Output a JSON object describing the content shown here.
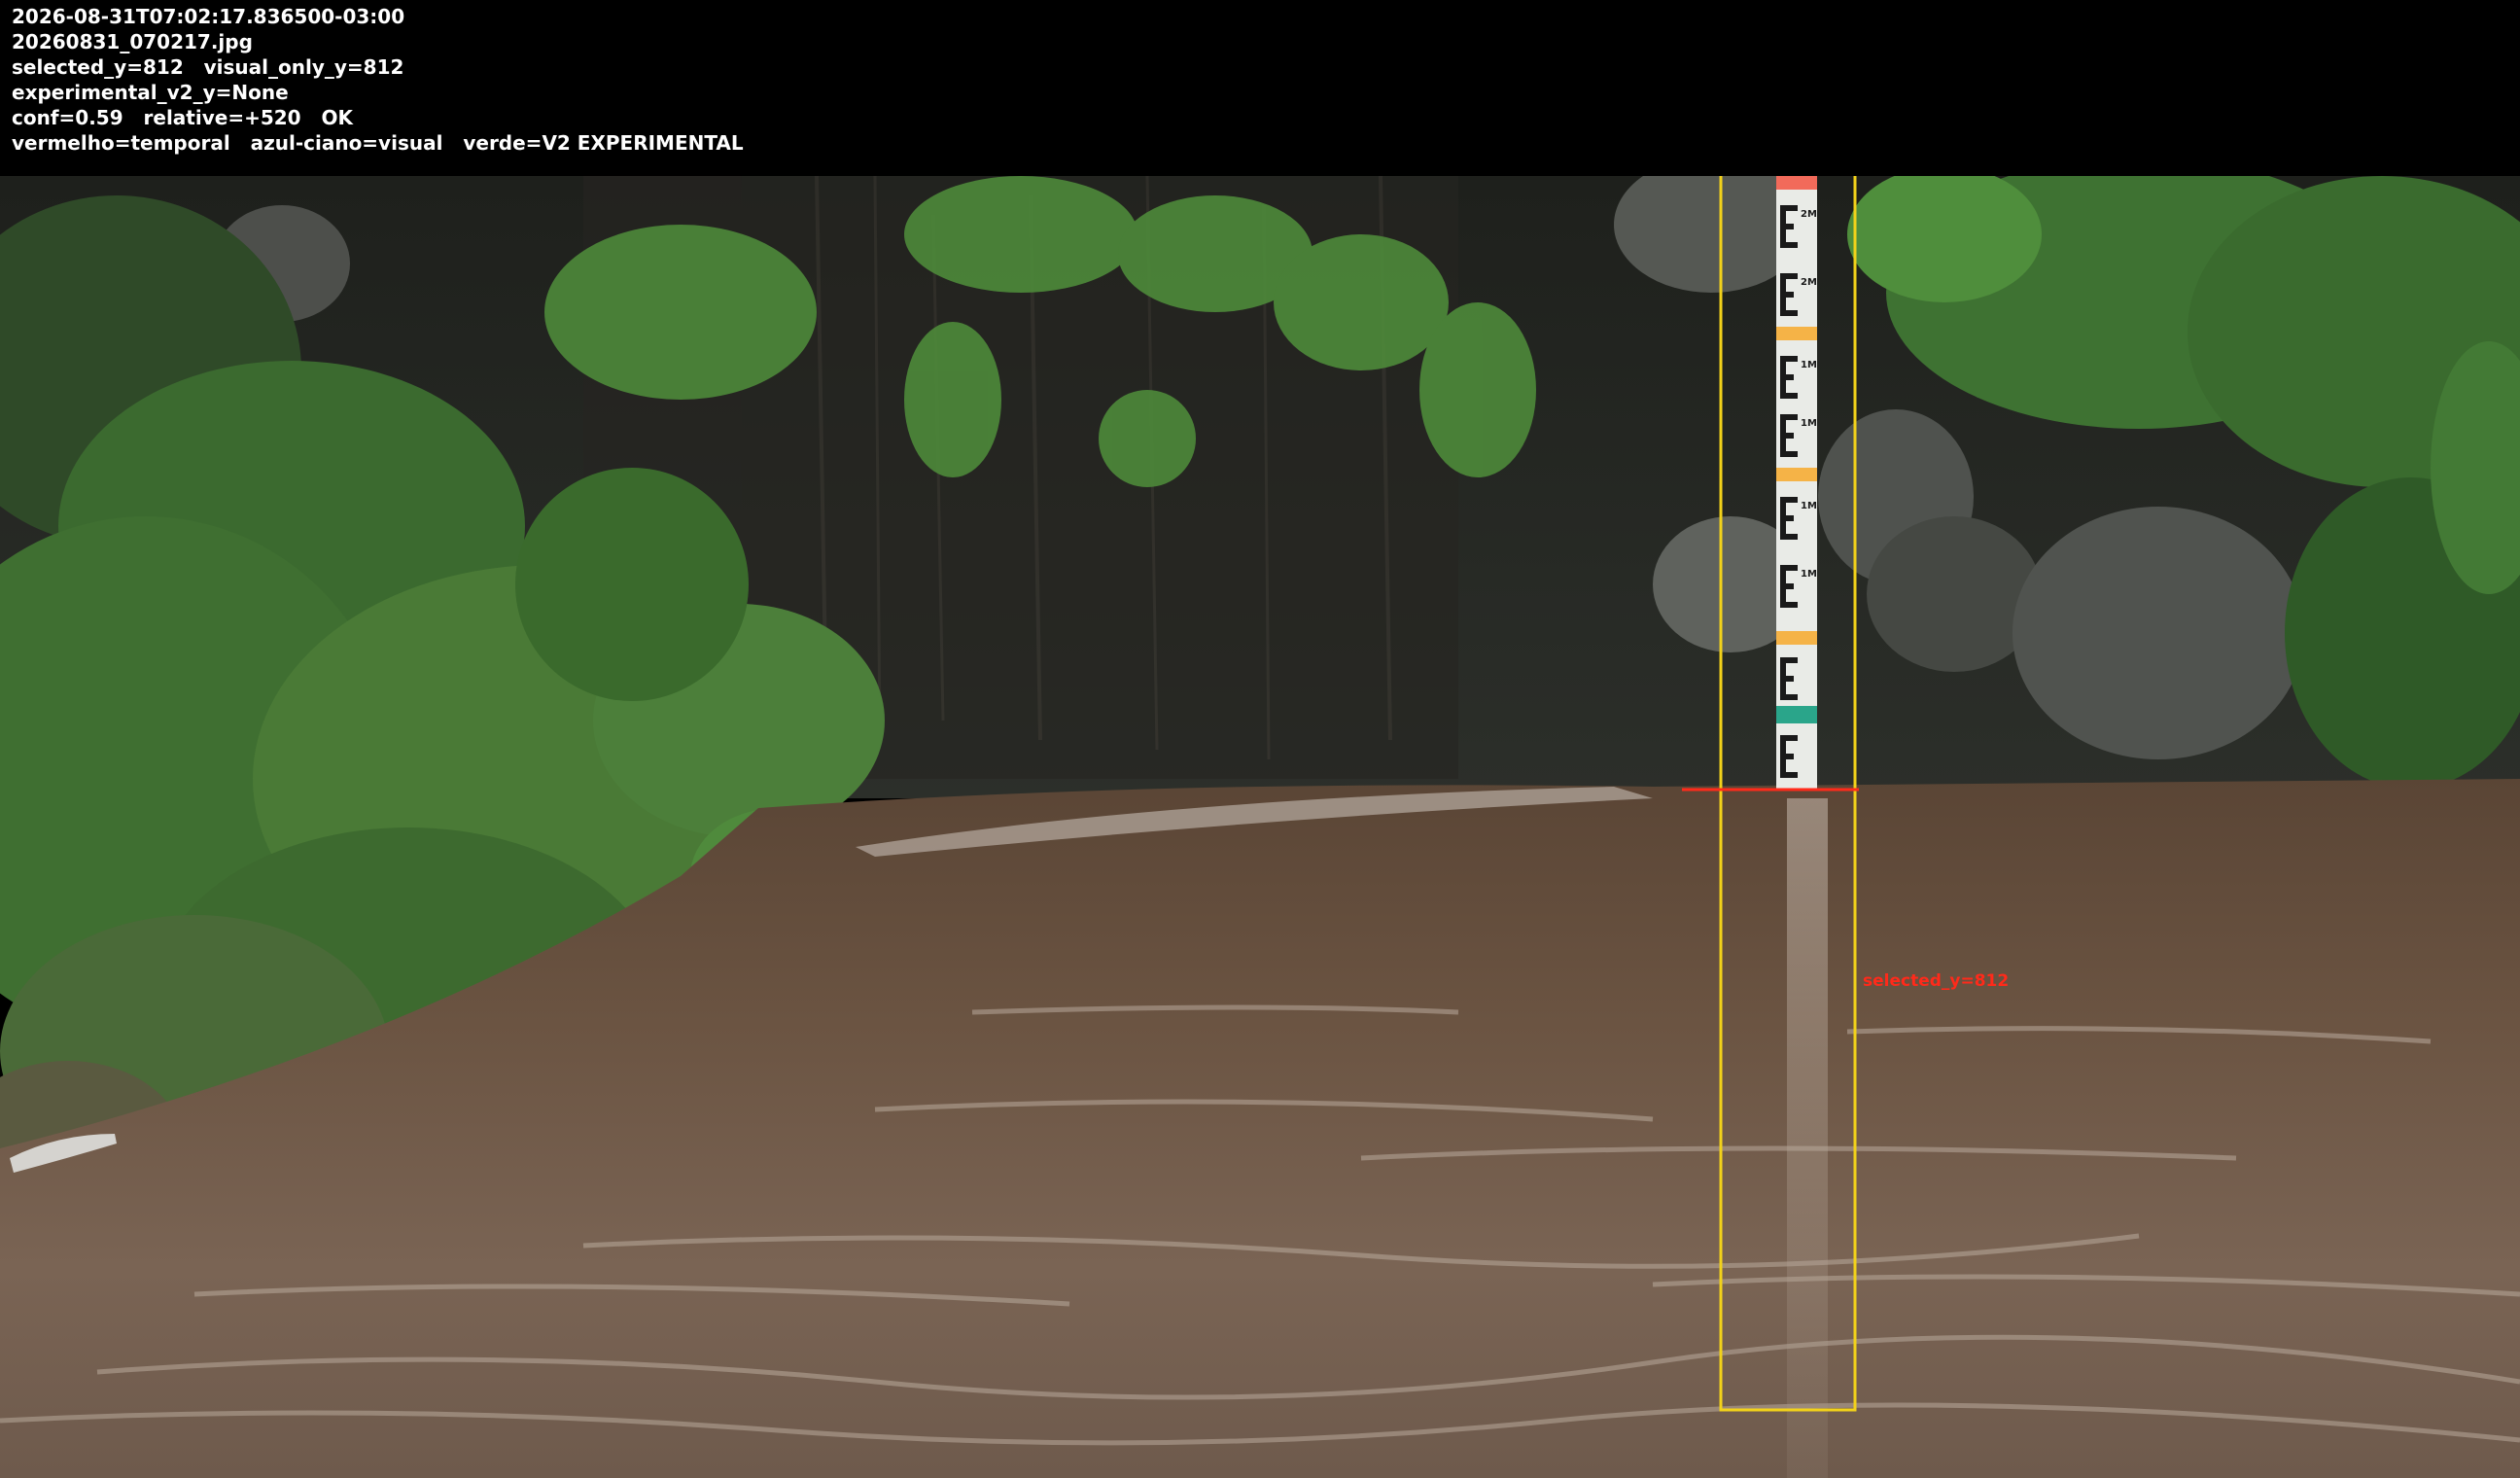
{
  "overlay": {
    "timestamp": "2026-08-31T07:02:17.836500-03:00",
    "filename": "20260831_070217.jpg",
    "selection_line": "selected_y=812   visual_only_y=812",
    "experimental_line": "experimental_v2_y=None",
    "confidence_line": "conf=0.59   relative=+520   OK",
    "legend_line": "vermelho=temporal   azul-ciano=visual   verde=V2 EXPERIMENTAL"
  },
  "water_line": {
    "label": "selected_y=812",
    "color": "#ff2a1a"
  },
  "gauge": {
    "roi_color": "#f2d21a",
    "band_colors": [
      "#f26a5a",
      "#f5b347",
      "#f5b347",
      "#f5b347",
      "#2aa58a"
    ],
    "segment_labels": [
      "2M",
      "2M",
      "1M",
      "1M",
      "1M",
      "1M"
    ]
  }
}
